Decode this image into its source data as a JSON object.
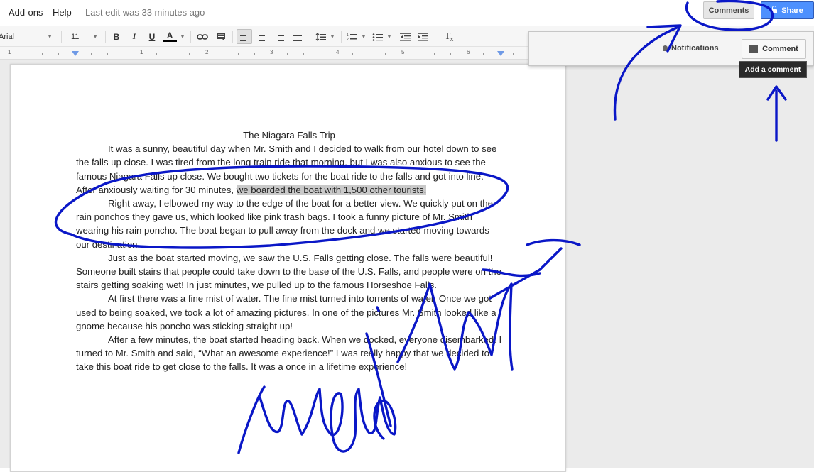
{
  "menu": {
    "addons": "Add-ons",
    "help": "Help",
    "last_edit": "Last edit was 33 minutes ago"
  },
  "header_buttons": {
    "comments": "Comments",
    "share": "Share"
  },
  "toolbar": {
    "font": "Arial",
    "size": "11",
    "bold": "B",
    "italic": "I",
    "underline": "U",
    "text_color": "A",
    "clear_format": "T",
    "text_color_swatch": "#000000"
  },
  "ruler": {
    "numbers": [
      "1",
      "1",
      "2",
      "3",
      "4",
      "5",
      "6"
    ]
  },
  "comments_panel": {
    "notifications": "Notifications",
    "comment_button": "Comment",
    "tooltip": "Add a comment"
  },
  "document": {
    "title": "The Niagara Falls Trip",
    "p1_before": "It was a sunny, beautiful day when Mr. Smith and I decided to walk from our hotel down to see the falls up close. I was tired from the long train ride that morning, but I was also anxious to see the famous Niagara Falls up close. We bought two tickets for the boat ride to the falls and got into line. After anxiously waiting for 30 minutes, ",
    "p1_highlight": "we boarded the boat with 1,500 other tourists. ",
    "p2": "Right away, I elbowed my way to the edge of the boat for a better view. We quickly put on the rain ponchos they gave us, which looked like pink trash bags. I took a funny picture of Mr. Smith wearing his rain poncho. The boat began to pull away from the dock and we started moving towards our destination.",
    "p3": "Just as the boat started moving, we saw the U.S. Falls getting close. The falls were beautiful! Someone built stairs that people could take down to the base of the U.S. Falls, and people were on the stairs getting soaking wet! In just minutes, we pulled up to the famous Horseshoe Falls.",
    "p4": "At first there was a fine mist of water. The fine mist turned into torrents of water. Once we got used to being soaked, we took a lot of amazing pictures. In one of the pictures Mr. Smith looked like a gnome because his poncho was sticking straight up!",
    "p5": "After a few minutes, the boat started heading back. When we docked, everyone disembarked. I turned to Mr. Smith and said, “What an awesome experience!” I was really happy that we decided to take this boat ride to get close to the falls. It was a once in a lifetime experience!"
  },
  "annotation": {
    "handwriting": "highlight",
    "ink_color": "#0a17c7"
  },
  "colors": {
    "share_blue": "#4d90fe",
    "highlight_gray": "#c9c9c9",
    "canvas_gray": "#ebebeb"
  }
}
